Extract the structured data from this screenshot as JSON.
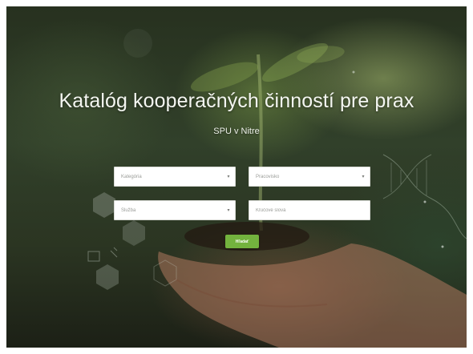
{
  "hero": {
    "title": "Katalóg kooperačných činností pre prax",
    "subtitle": "SPU v Nitre"
  },
  "filters": {
    "category": {
      "value": "Kategória",
      "icon": "chevron-down-icon"
    },
    "workplace": {
      "value": "Pracovisko",
      "icon": "chevron-down-icon"
    },
    "field": {
      "value": "Služba",
      "icon": "chevron-down-icon"
    },
    "keywords": {
      "placeholder": "Kľúčové slová"
    }
  },
  "actions": {
    "search_label": "Hľadať"
  },
  "colors": {
    "accent": "#73b33e",
    "overlay": "#2b3522",
    "text": "#f4f6f1"
  }
}
